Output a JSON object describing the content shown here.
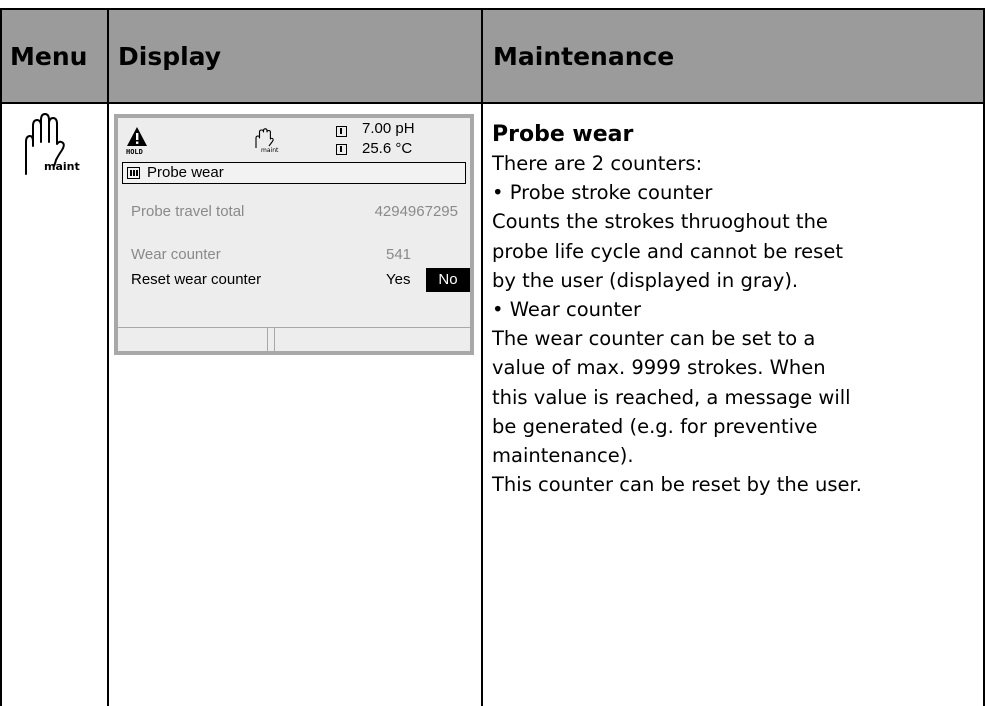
{
  "header": {
    "menu": "Menu",
    "display": "Display",
    "maintenance": "Maintenance"
  },
  "menu_icon": {
    "name": "hand-icon",
    "label": "maint"
  },
  "display": {
    "status": {
      "warning_icon": "warning-triangle-icon",
      "hold_label": "HOLD",
      "maint_icon": "hand-icon",
      "maint_label": "maint",
      "value1": "7.00 pH",
      "value2": "25.6 °C"
    },
    "title": "Probe wear",
    "rows": [
      {
        "label": "Probe travel total",
        "value": "4294967295"
      },
      {
        "label": "Wear counter",
        "value": "541"
      },
      {
        "label": "Reset wear counter",
        "options": [
          "Yes",
          "No"
        ],
        "selected": "No"
      }
    ]
  },
  "maintenance": {
    "title": "Probe wear",
    "lines": [
      "There are 2 counters:",
      "• Probe stroke counter",
      "Counts the strokes thruoghout the",
      "probe life cycle and cannot be reset",
      "by the user (displayed in gray).",
      "• Wear counter",
      "The wear counter can be set to a",
      "value of max. 9999 strokes. When",
      "this value is reached, a message will",
      "be generated (e.g. for preventive",
      "maintenance).",
      "This counter can be reset by the user."
    ]
  }
}
